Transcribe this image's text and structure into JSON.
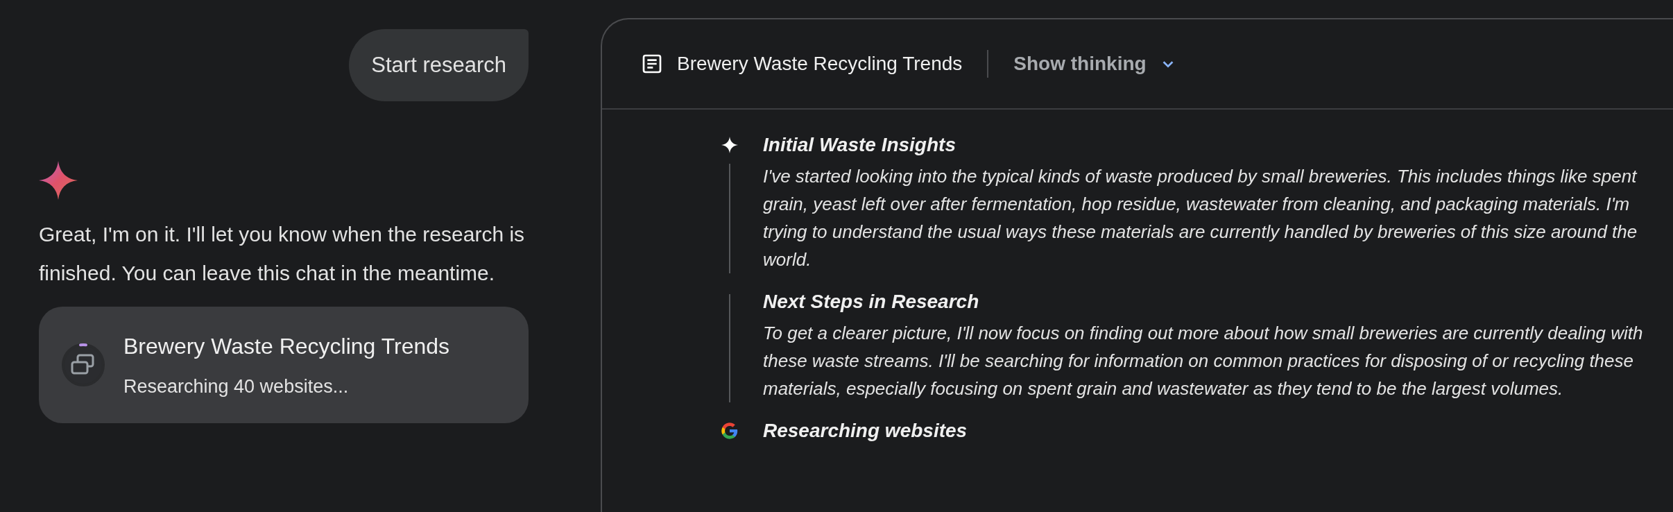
{
  "chat": {
    "user_message": "Start research",
    "reply": "Great, I'm on it. I'll let you know when the research is finished. You can leave this chat in the meantime.",
    "research_card": {
      "title": "Brewery Waste Recycling Trends",
      "status": "Researching 40 websites..."
    }
  },
  "panel": {
    "title": "Brewery Waste Recycling Trends",
    "toggle": {
      "label": "Show thinking",
      "expanded": false
    },
    "steps": [
      {
        "kind": "thought",
        "title": "Initial Waste Insights",
        "text": "I've started looking into the typical kinds of waste produced by small breweries. This includes things like spent grain, yeast left over after fermentation, hop residue, wastewater from cleaning, and packaging materials. I'm trying to understand the usual ways these materials are currently handled by breweries of this size around the world."
      },
      {
        "kind": "thought_continued",
        "title": "Next Steps in Research",
        "text": "To get a clearer picture, I'll now focus on finding out more about how small breweries are currently dealing with these waste streams. I'll be searching for information on common practices for disposing of or recycling these materials, especially focusing on spent grain and wastewater as they tend to be the largest volumes."
      },
      {
        "kind": "search",
        "title": "Researching websites"
      }
    ]
  }
}
